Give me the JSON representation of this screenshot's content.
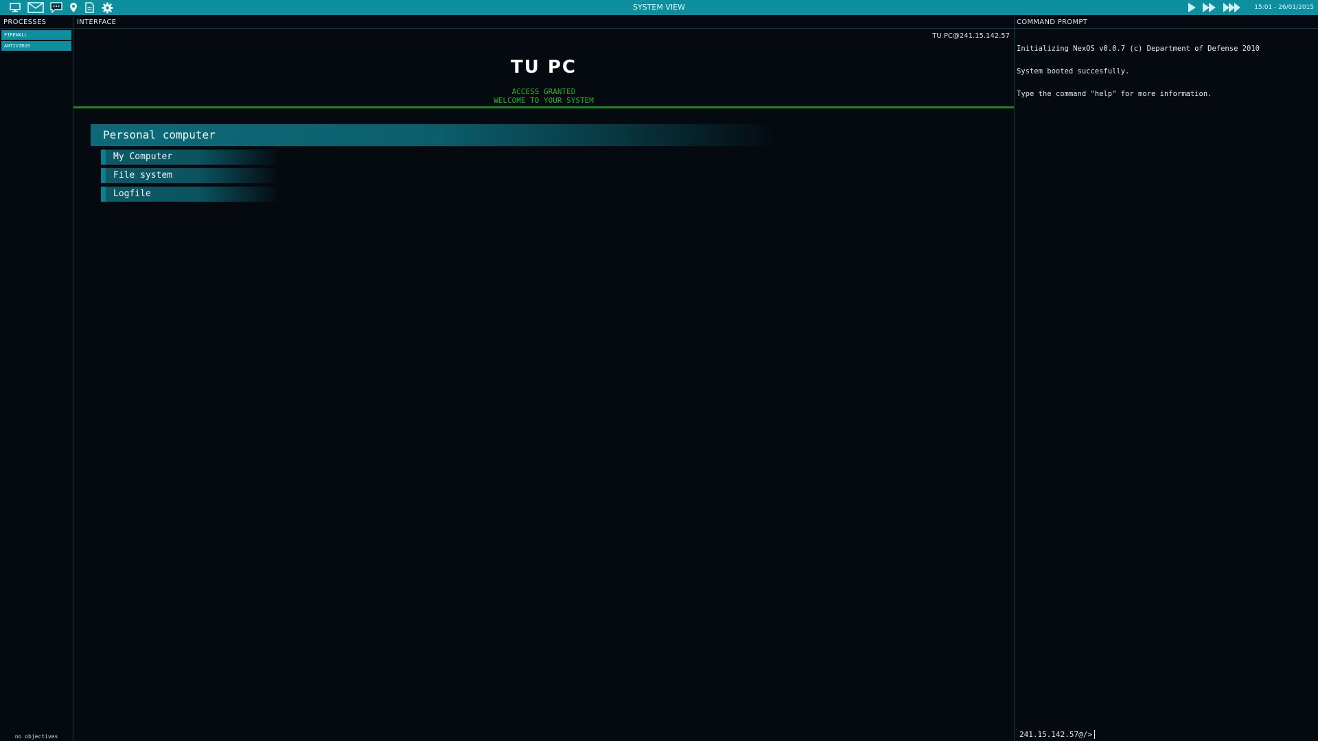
{
  "topbar": {
    "icons": [
      "monitor-icon",
      "mail-icon",
      "chat-icon",
      "location-icon",
      "document-icon",
      "gear-icon"
    ],
    "title": "SYSTEM VIEW",
    "speed_controls": [
      "play-icon",
      "fast-forward-icon",
      "fastest-forward-icon"
    ],
    "clock": "15:01 - 26/01/2015",
    "colors": {
      "bar": "#0e8fa0"
    }
  },
  "processes": {
    "header": "PROCESSES",
    "items": [
      {
        "label": "FIREWALL"
      },
      {
        "label": "ANTIVIRUS"
      }
    ],
    "objectives": "no objectives"
  },
  "interface": {
    "header": "INTERFACE",
    "host_id": "TU PC@241.15.142.57",
    "title": "TU PC",
    "access_line1": "ACCESS GRANTED",
    "access_line2": "WELCOME TO YOUR SYSTEM",
    "section_title": "Personal computer",
    "menu": [
      {
        "label": "My Computer"
      },
      {
        "label": "File system"
      },
      {
        "label": "Logfile"
      }
    ],
    "colors": {
      "accent_green": "#22b32a",
      "section": "#0c6a78"
    }
  },
  "command_prompt": {
    "header": "COMMAND PROMPT",
    "lines": [
      "Initializing NexOS v0.0.7 (c) Department of Defense 2010",
      "System booted succesfully.",
      "Type the command \"help\" for more information."
    ],
    "prompt": "241.15.142.57@/>"
  }
}
